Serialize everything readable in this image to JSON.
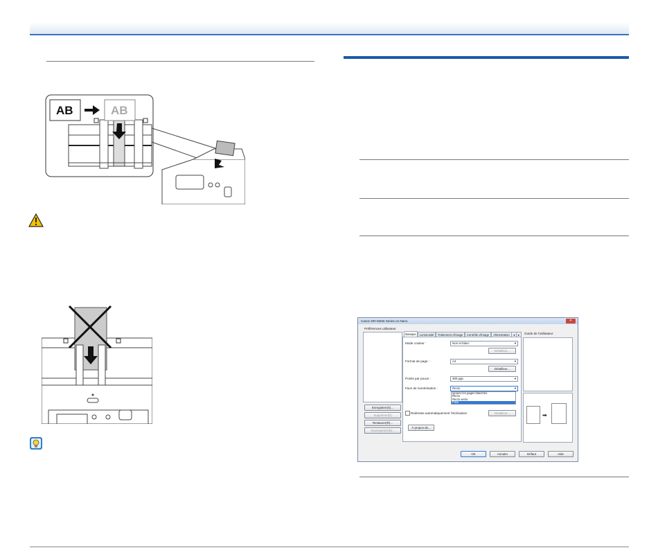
{
  "dialog": {
    "title": "Canon DR-M260 Series on Nano",
    "close_symbol": "✕",
    "left_panel": {
      "label": "Préférences utilisateur",
      "buttons": [
        "Enregistrer(S)...",
        "Supprimer(D)",
        "Restaurer(R)...",
        "Sauvegarder(B)..."
      ]
    },
    "tabs": [
      "Basique",
      "Luminosité",
      "Traitement d'image",
      "Contrôle d'image",
      "Alimentation"
    ],
    "tab_arrows": [
      "◂",
      "▸"
    ],
    "fields": {
      "mode_label": "Mode couleur :",
      "mode_value": "Noir et blanc",
      "mode_details": "Détailleur...",
      "page_label": "Format de page :",
      "page_value": "A4",
      "page_details": "Détailleur...",
      "dpi_label": "Points par pouce :",
      "dpi_value": "300 ppp",
      "side_label": "Face de numérisation :",
      "side_value": "Recto",
      "side_options": [
        "Ignorer les pages blanches",
        "Recto",
        "Recto verso",
        "Pliée"
      ],
      "side_selected_index": 3,
      "deskew_label": "Redresse automatiquement l'inclinaison",
      "deskew_details": "Détailleur...",
      "about_button": "À propos de..."
    },
    "guide_label": "Guide de l'utilisateur",
    "footer_buttons": [
      "OK",
      "Annuler",
      "Défaut",
      "Aide"
    ]
  },
  "figure_labels": {
    "card_front": "AB",
    "card_back": "AB"
  },
  "colors": {
    "header_rule": "#3a6fc0",
    "section_rule": "#1c5aa8",
    "warning": "#f2c200",
    "hint": "#2e7fc4",
    "selection": "#3178d8"
  },
  "icons": [
    "warning-icon",
    "hint-icon"
  ]
}
